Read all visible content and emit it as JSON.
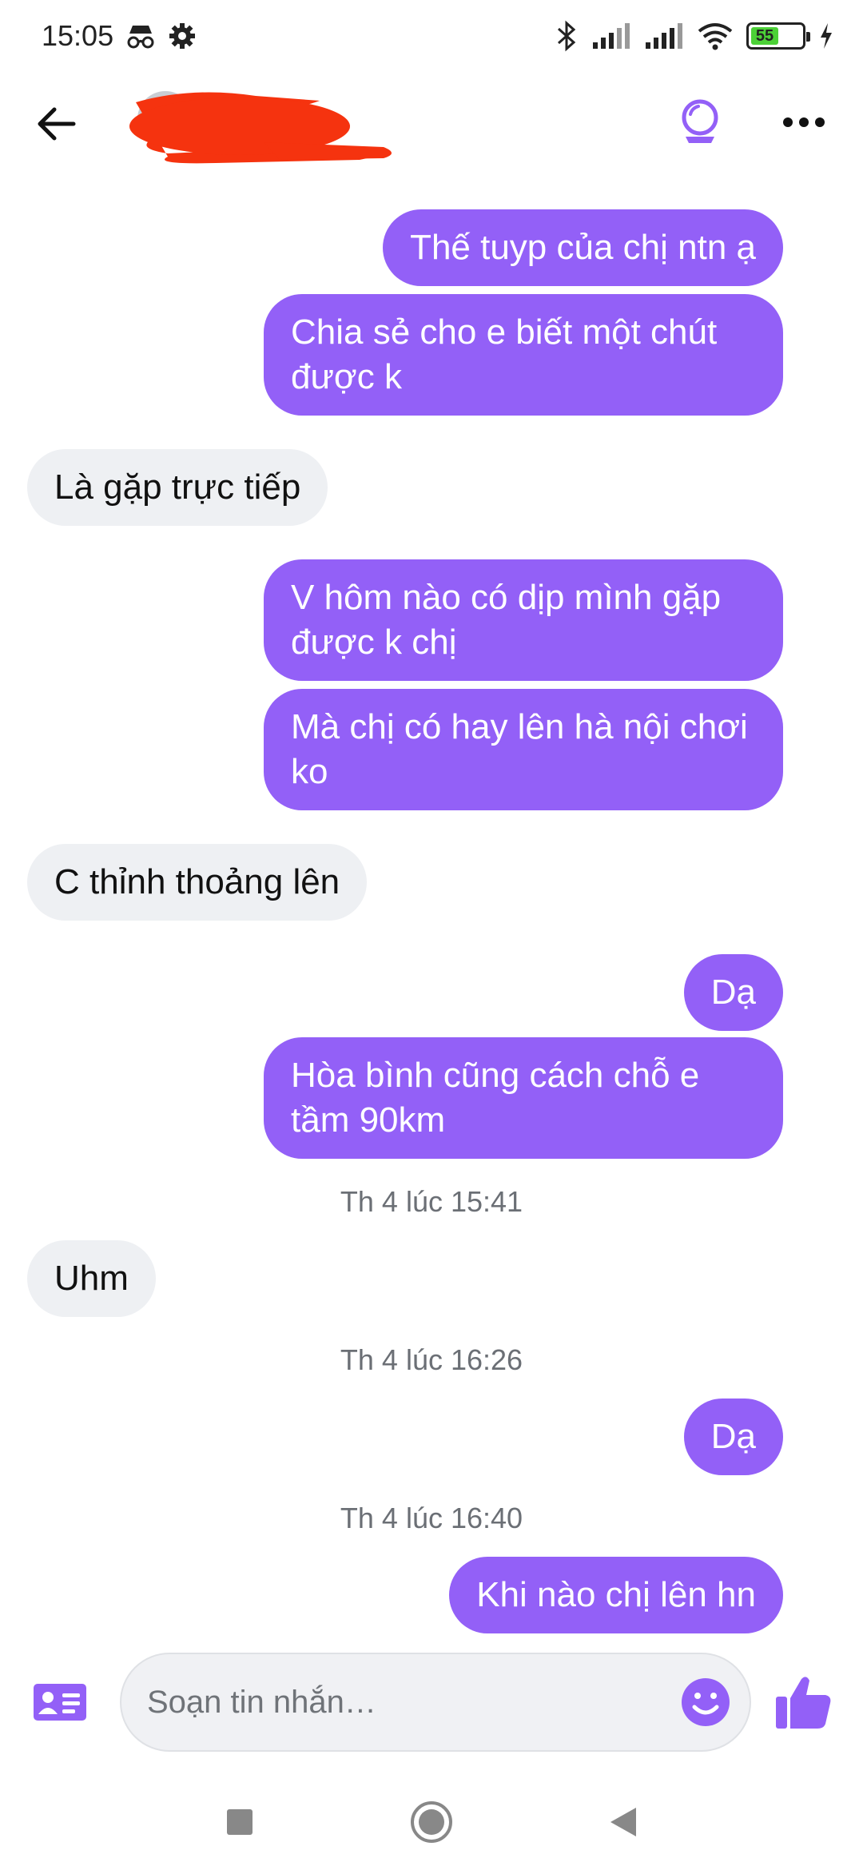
{
  "status_bar": {
    "time": "15:05",
    "icons": [
      "incognito-icon",
      "gear-icon",
      "bluetooth-icon",
      "signal-icon",
      "signal-icon",
      "wifi-icon",
      "battery-icon",
      "charging-icon"
    ],
    "battery_level": "55"
  },
  "header": {
    "contact_name": "",
    "icons": [
      "back-arrow-icon",
      "crystal-ball-icon",
      "more-icon"
    ]
  },
  "messages": [
    {
      "direction": "out",
      "text": "Thế tuyp của chị ntn ạ"
    },
    {
      "direction": "out",
      "text": "Chia sẻ cho e biết một chút được k"
    },
    {
      "direction": "in",
      "text": "Là gặp trực tiếp"
    },
    {
      "direction": "out",
      "text": "V hôm nào có dịp mình gặp được k chị"
    },
    {
      "direction": "out",
      "text": "Mà chị có hay lên hà nội chơi ko"
    },
    {
      "direction": "in",
      "text": "C thỉnh thoảng lên"
    },
    {
      "direction": "out",
      "text": "Dạ"
    },
    {
      "direction": "out",
      "text": "Hòa bình cũng cách chỗ e tầm 90km"
    },
    {
      "direction": "in",
      "text": "Uhm"
    },
    {
      "direction": "out",
      "text": "Dạ"
    },
    {
      "direction": "out",
      "text": "Khi nào chị lên hn"
    }
  ],
  "timestamps": [
    "Th 4 lúc 15:41",
    "Th 4 lúc 16:26",
    "Th 4 lúc 16:40"
  ],
  "composer": {
    "placeholder": "Soạn tin nhắn…",
    "value": "",
    "icons": [
      "contact-card-icon",
      "emoji-icon",
      "thumbs-up-icon"
    ]
  },
  "nav_bar": {
    "icons": [
      "recents-icon",
      "home-icon",
      "back-icon"
    ]
  },
  "colors": {
    "accent": "#9360f7",
    "incoming_bubble": "#eef0f3",
    "redaction": "#f5330f"
  }
}
